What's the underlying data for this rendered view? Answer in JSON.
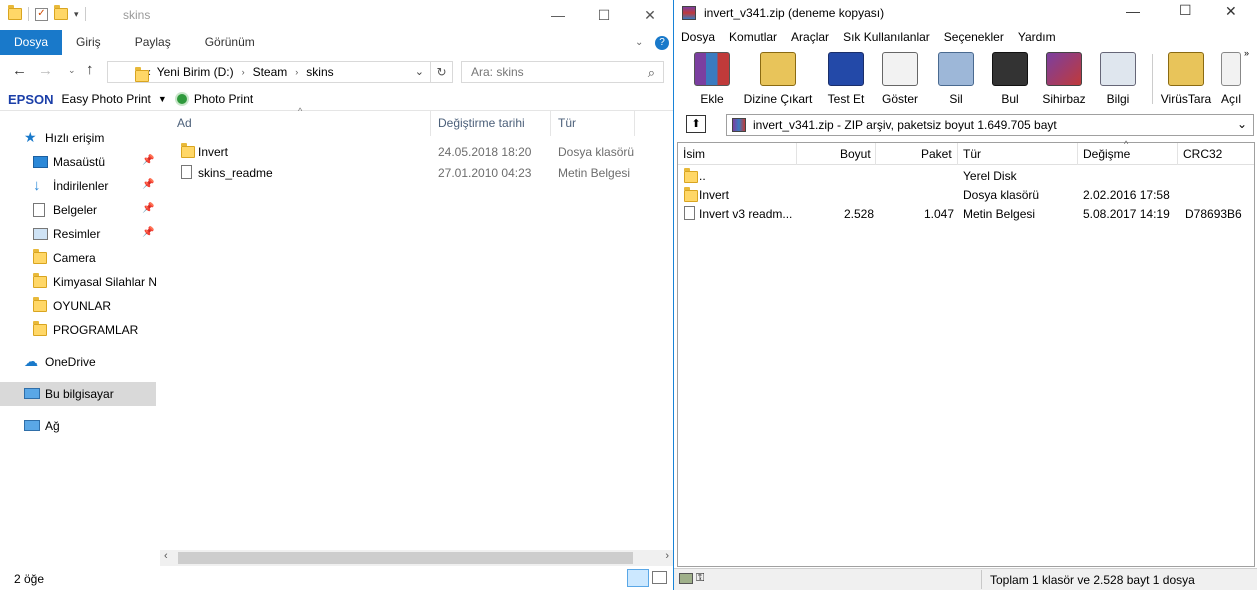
{
  "explorer": {
    "title": "skins",
    "ribbon_tabs": [
      "Dosya",
      "Giriş",
      "Paylaş",
      "Görünüm"
    ],
    "address": {
      "prefix": "«",
      "crumbs": [
        "Yeni Birim (D:)",
        "Steam",
        "skins"
      ]
    },
    "search_placeholder": "Ara: skins",
    "epson": {
      "brand": "EPSON",
      "app": "Easy Photo Print",
      "photo_print": "Photo Print"
    },
    "nav": {
      "quick_access": "Hızlı erişim",
      "items": [
        "Masaüstü",
        "İndirilenler",
        "Belgeler",
        "Resimler",
        "Camera",
        "Kimyasal Silahlar Ne",
        "OYUNLAR",
        "PROGRAMLAR"
      ],
      "onedrive": "OneDrive",
      "this_pc": "Bu bilgisayar",
      "network": "Ağ"
    },
    "columns": {
      "name": "Ad",
      "modified": "Değiştirme tarihi",
      "type": "Tür"
    },
    "files": [
      {
        "name": "Invert",
        "modified": "24.05.2018 18:20",
        "type": "Dosya klasörü",
        "icon": "folder-icon"
      },
      {
        "name": "skins_readme",
        "modified": "27.01.2010 04:23",
        "type": "Metin Belgesi",
        "icon": "text-file-icon"
      }
    ],
    "status": "2 öğe"
  },
  "winrar": {
    "title": "invert_v341.zip (deneme kopyası)",
    "menu": [
      "Dosya",
      "Komutlar",
      "Araçlar",
      "Sık Kullanılanlar",
      "Seçenekler",
      "Yardım"
    ],
    "toolbar": [
      "Ekle",
      "Dizine Çıkart",
      "Test Et",
      "Göster",
      "Sil",
      "Bul",
      "Sihirbaz",
      "Bilgi",
      "VirüsTara",
      "Açıl"
    ],
    "path": "invert_v341.zip - ZIP arşiv, paketsiz boyut 1.649.705 bayt",
    "columns": {
      "name": "İsim",
      "size": "Boyut",
      "packed": "Paket",
      "type": "Tür",
      "modified": "Değişme",
      "crc": "CRC32"
    },
    "rows": [
      {
        "name": "..",
        "size": "",
        "packed": "",
        "type": "Yerel Disk",
        "modified": "",
        "crc": ""
      },
      {
        "name": "Invert",
        "size": "",
        "packed": "",
        "type": "Dosya klasörü",
        "modified": "2.02.2016 17:58",
        "crc": ""
      },
      {
        "name": "Invert v3 readm...",
        "size": "2.528",
        "packed": "1.047",
        "type": "Metin Belgesi",
        "modified": "5.08.2017 14:19",
        "crc": "D78693B6"
      }
    ],
    "status": "Toplam 1 klasör ve 2.528 bayt 1 dosya"
  },
  "colors": {
    "accent": "#1979ca",
    "folder": "#ffd767",
    "selected_nav": "#cce8ff"
  }
}
